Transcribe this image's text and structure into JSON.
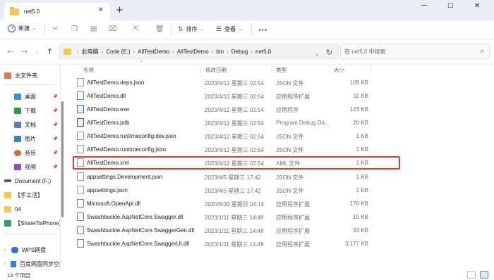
{
  "window": {
    "tab_title": "net5.0",
    "new_tab": "+",
    "close_tab": "✕",
    "minimize": "—",
    "maximize": "☐",
    "close": "✕"
  },
  "toolbar": {
    "new_label": "新建",
    "sort_label": "排序",
    "view_label": "查看",
    "more_label": "···"
  },
  "address": {
    "crumbs": [
      "此电脑",
      "Code (E:)",
      "AllTestDemo",
      "AllTestDemo",
      "bin",
      "Debug",
      "net5.0"
    ],
    "search_placeholder": "在 net5.0 中搜索"
  },
  "sidebar": {
    "items": [
      {
        "label": "主文件夹",
        "icon": "home-icon",
        "pinned": false,
        "color": "#e0794a"
      },
      {
        "label": "桌面",
        "icon": "desktop-icon",
        "pinned": true,
        "color": "#3a8fd8"
      },
      {
        "label": "下载",
        "icon": "download-icon",
        "pinned": true,
        "color": "#2a9d4b"
      },
      {
        "label": "文档",
        "icon": "documents-icon",
        "pinned": true,
        "color": "#5a7fb8"
      },
      {
        "label": "图片",
        "icon": "pictures-icon",
        "pinned": true,
        "color": "#3b82c4"
      },
      {
        "label": "音乐",
        "icon": "music-icon",
        "pinned": true,
        "color": "#e0603a"
      },
      {
        "label": "视频",
        "icon": "videos-icon",
        "pinned": true,
        "color": "#8a4fc2"
      },
      {
        "label": "Document (F:)",
        "icon": "drive-icon",
        "pinned": false,
        "color": "#5a5a5a"
      },
      {
        "label": "【手工活】",
        "icon": "folder-icon",
        "pinned": false,
        "color": "#f5c84c"
      },
      {
        "label": "04",
        "icon": "folder-icon",
        "pinned": false,
        "color": "#f5c84c"
      },
      {
        "label": "【ShareToiPhone】",
        "icon": "app-icon",
        "pinned": false,
        "color": "#2a9d6b"
      },
      {
        "label": "WPS网盘",
        "icon": "cloud-icon",
        "pinned": false,
        "color": "#3a6fd8"
      },
      {
        "label": "百度网盘同步空间",
        "icon": "baidu-icon",
        "pinned": false,
        "color": "#2f7ee0"
      }
    ]
  },
  "columns": {
    "name": "名称",
    "date": "修改日期",
    "type": "类型",
    "size": "大小"
  },
  "files": [
    {
      "name": "AllTestDemo.deps.json",
      "date": "2023/4/12 星期三 02:54",
      "type": "JSON 文件",
      "size": "109 KB",
      "icon": "file-icon"
    },
    {
      "name": "AllTestDemo.dll",
      "date": "2023/4/12 星期三 02:54",
      "type": "应用程序扩展",
      "size": "11 KB",
      "icon": "dll-icon"
    },
    {
      "name": "AllTestDemo.exe",
      "date": "2023/4/12 星期三 02:54",
      "type": "应用程序",
      "size": "123 KB",
      "icon": "exe-icon"
    },
    {
      "name": "AllTestDemo.pdb",
      "date": "2023/4/12 星期三 02:54",
      "type": "Program Debug Da...",
      "size": "20 KB",
      "icon": "pdb-icon"
    },
    {
      "name": "AllTestDemo.runtimeconfig.dev.json",
      "date": "2023/4/12 星期三 02:54",
      "type": "JSON 文件",
      "size": "1 KB",
      "icon": "file-icon"
    },
    {
      "name": "AllTestDemo.runtimeconfig.json",
      "date": "2023/4/12 星期三 02:54",
      "type": "JSON 文件",
      "size": "1 KB",
      "icon": "file-icon"
    },
    {
      "name": "AllTestDemo.xml",
      "date": "2023/4/12 星期三 02:54",
      "type": "XML 文件",
      "size": "1 KB",
      "icon": "file-icon"
    },
    {
      "name": "appsettings.Development.json",
      "date": "2023/4/5 星期三 17:42",
      "type": "JSON 文件",
      "size": "1 KB",
      "icon": "file-icon"
    },
    {
      "name": "appsettings.json",
      "date": "2023/4/5 星期三 17:42",
      "type": "JSON 文件",
      "size": "1 KB",
      "icon": "file-icon"
    },
    {
      "name": "Microsoft.OpenApi.dll",
      "date": "2020/8/30 星期日 04:14",
      "type": "应用程序扩展",
      "size": "170 KB",
      "icon": "dll-icon"
    },
    {
      "name": "Swashbuckle.AspNetCore.Swagger.dll",
      "date": "2023/1/11 星期三 14:48",
      "type": "应用程序扩展",
      "size": "15 KB",
      "icon": "dll-icon"
    },
    {
      "name": "Swashbuckle.AspNetCore.SwaggerGen.dll",
      "date": "2023/1/11 星期三 14:48",
      "type": "应用程序扩展",
      "size": "93 KB",
      "icon": "dll-icon"
    },
    {
      "name": "Swashbuckle.AspNetCore.SwaggerUI.dll",
      "date": "2023/1/11 星期三 14:49",
      "type": "应用程序扩展",
      "size": "3,177 KB",
      "icon": "dll-icon"
    }
  ],
  "highlighted_row": "AllTestDemo.xml",
  "colors": {
    "highlight": "#e53935",
    "titlebar": "#e9eef6",
    "folder": "#f5c84c"
  },
  "status": {
    "count_text": "13 个项目"
  }
}
